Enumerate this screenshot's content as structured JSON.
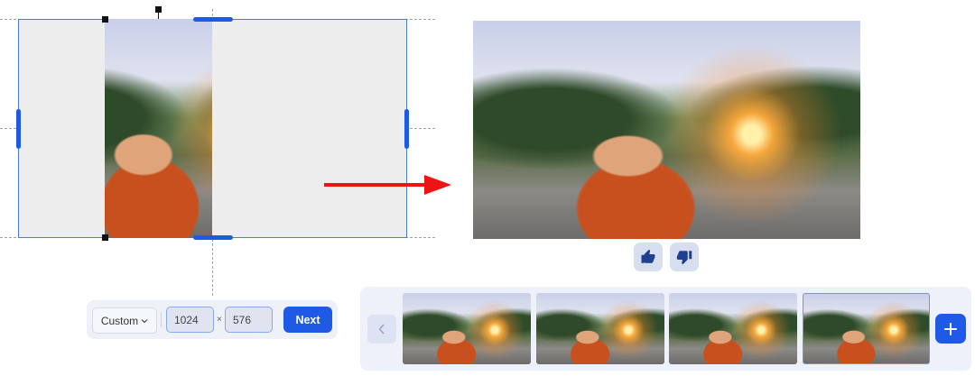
{
  "toolbar": {
    "aspect_label": "Custom",
    "width_value": "1024",
    "height_value": "576",
    "separator": "×",
    "next_label": "Next"
  },
  "feedback": {
    "like_icon": "thumbs-up-icon",
    "dislike_icon": "thumbs-down-icon"
  },
  "filmstrip": {
    "thumbnail_count": 4,
    "selected_index": 3,
    "prev_icon": "chevron-left-icon",
    "add_icon": "plus-icon"
  },
  "colors": {
    "accent": "#1f5ae6",
    "arrow": "#ee1414"
  }
}
